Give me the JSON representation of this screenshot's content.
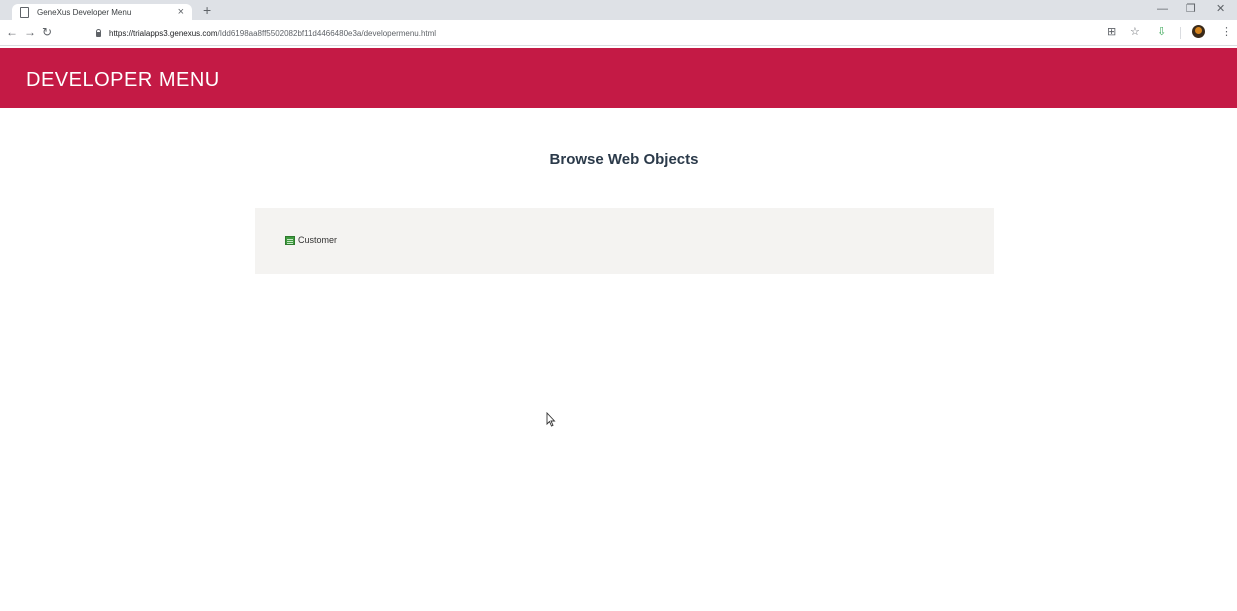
{
  "browser": {
    "tab": {
      "title": "GeneXus Developer Menu",
      "close_icon": "close-icon"
    },
    "new_tab_icon": "plus-icon",
    "window_controls": [
      "minimize-icon",
      "restore-icon",
      "close-icon"
    ],
    "nav": {
      "back_icon": "arrow-left-icon",
      "forward_icon": "arrow-right-icon",
      "reload_icon": "reload-icon"
    },
    "url": {
      "host": "https://trialapps3.genexus.com",
      "path": "/Idd6198aa8ff5502082bf11d4466480e3a/developermenu.html"
    },
    "toolbar_icons": [
      "translate-icon",
      "star-icon",
      "extension-icon",
      "profile-avatar",
      "menu-icon"
    ]
  },
  "header": {
    "title": "DEVELOPER MENU",
    "color": "#c41a45"
  },
  "main": {
    "section_title": "Browse Web Objects",
    "objects": [
      {
        "label": "Customer",
        "icon": "grid-icon"
      }
    ]
  }
}
